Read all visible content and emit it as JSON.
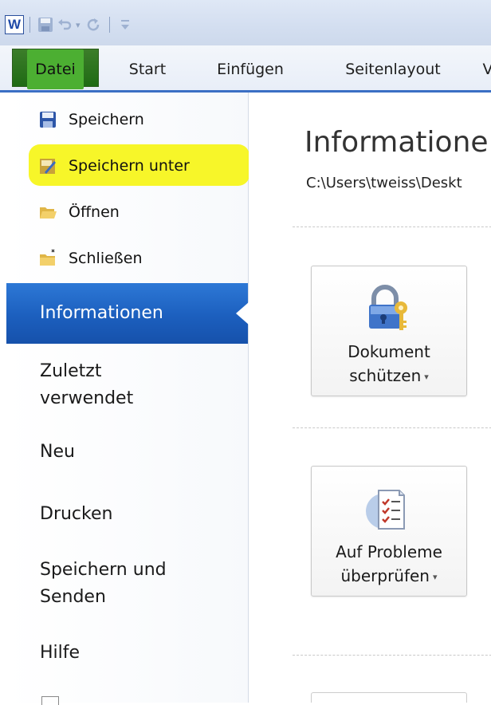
{
  "qat": {
    "app_icon": "word-icon",
    "app_letter": "W",
    "save_icon": "floppy-icon",
    "undo_icon": "undo-icon",
    "redo_icon": "repeat-icon",
    "customize_icon": "customize-qat-icon"
  },
  "tabs": {
    "file": "Datei",
    "items": [
      "Start",
      "Einfügen",
      "Seitenlayout",
      "V"
    ]
  },
  "nav": {
    "commands": [
      {
        "label": "Speichern",
        "icon": "floppy-icon"
      },
      {
        "label": "Speichern unter",
        "icon": "save-as-icon"
      },
      {
        "label": "Öffnen",
        "icon": "open-folder-icon"
      },
      {
        "label": "Schließen",
        "icon": "close-folder-icon"
      }
    ],
    "selected": "Informationen",
    "items": [
      "Zuletzt",
      "verwendet",
      "Neu",
      "Drucken",
      "Speichern und",
      "Senden",
      "Hilfe"
    ]
  },
  "main": {
    "title": "Informatione",
    "path": "C:\\Users\\tweiss\\Deskt",
    "protect": {
      "line1": "Dokument",
      "line2": "schützen",
      "caret": "▾",
      "icon": "padlock-key-icon"
    },
    "inspect": {
      "line1": "Auf Probleme",
      "line2": "überprüfen",
      "caret": "▾",
      "icon": "checklist-icon"
    }
  },
  "colors": {
    "file_tab": "#2d7a1f",
    "highlight": "#f7f61e",
    "selected_nav": "#1f62c3"
  }
}
